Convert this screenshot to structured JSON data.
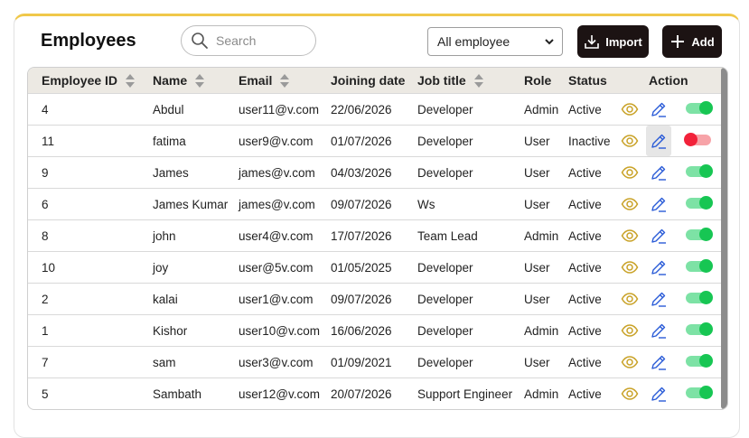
{
  "header": {
    "title": "Employees",
    "search_placeholder": "Search",
    "filter_selected": "All employee",
    "import_label": "Import",
    "add_label": "Add"
  },
  "table": {
    "columns": {
      "id": "Employee ID",
      "name": "Name",
      "email": "Email",
      "joining": "Joining date",
      "job": "Job title",
      "role": "Role",
      "status": "Status",
      "action": "Action"
    },
    "rows": [
      {
        "id": "4",
        "name": "Abdul",
        "email": "user11@v.com",
        "joining": "22/06/2026",
        "job": "Developer",
        "role": "Admin",
        "status": "Active",
        "active": true
      },
      {
        "id": "11",
        "name": "fatima",
        "email": "user9@v.com",
        "joining": "01/07/2026",
        "job": "Developer",
        "role": "User",
        "status": "Inactive",
        "active": false
      },
      {
        "id": "9",
        "name": "James",
        "email": "james@v.com",
        "joining": "04/03/2026",
        "job": "Developer",
        "role": "User",
        "status": "Active",
        "active": true
      },
      {
        "id": "6",
        "name": "James Kumar",
        "email": "james@v.com",
        "joining": "09/07/2026",
        "job": "Ws",
        "role": "User",
        "status": "Active",
        "active": true
      },
      {
        "id": "8",
        "name": "john",
        "email": "user4@v.com",
        "joining": "17/07/2026",
        "job": "Team Lead",
        "role": "Admin",
        "status": "Active",
        "active": true
      },
      {
        "id": "10",
        "name": "joy",
        "email": "user@5v.com",
        "joining": "01/05/2025",
        "job": "Developer",
        "role": "User",
        "status": "Active",
        "active": true
      },
      {
        "id": "2",
        "name": "kalai",
        "email": "user1@v.com",
        "joining": "09/07/2026",
        "job": "Developer",
        "role": "User",
        "status": "Active",
        "active": true
      },
      {
        "id": "1",
        "name": "Kishor",
        "email": "user10@v.com",
        "joining": "16/06/2026",
        "job": "Developer",
        "role": "Admin",
        "status": "Active",
        "active": true
      },
      {
        "id": "7",
        "name": "sam",
        "email": "user3@v.com",
        "joining": "01/09/2021",
        "job": "Developer",
        "role": "User",
        "status": "Active",
        "active": true
      },
      {
        "id": "5",
        "name": "Sambath",
        "email": "user12@v.com",
        "joining": "20/07/2026",
        "job": "Support Engineer",
        "role": "Admin",
        "status": "Active",
        "active": true
      }
    ]
  },
  "icons": {
    "view": "eye-icon",
    "edit": "pencil-icon",
    "toggle": "status-toggle"
  },
  "colors": {
    "accent_top": "#f0c84a",
    "button_bg": "#1c1313",
    "eye": "#c9a227",
    "pencil": "#2a5bd7",
    "toggle_on": "#17c653",
    "toggle_off": "#f2223a"
  }
}
